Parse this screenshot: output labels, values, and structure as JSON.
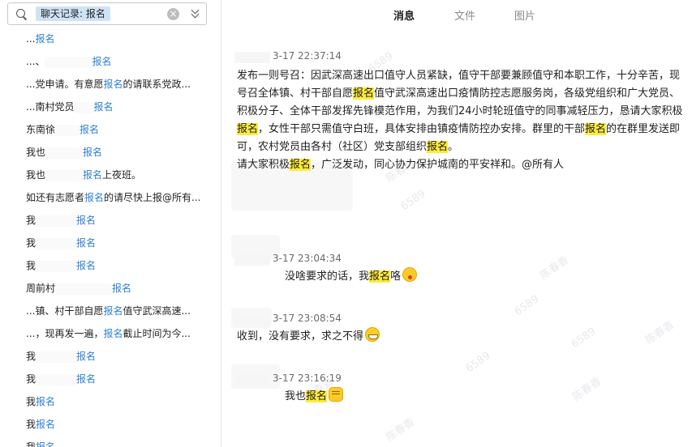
{
  "search": {
    "tag": "聊天记录: 报名",
    "clear_symbol": "×"
  },
  "results": [
    {
      "pre": "...",
      "hit": "报名",
      "post": ""
    },
    {
      "pre": "...、",
      "hit": "报名",
      "post": ""
    },
    {
      "pre": "...党申请。有意愿",
      "hit": "报名",
      "post": "的请联系党政..."
    },
    {
      "pre": "...南村党员",
      "hit": "报名",
      "post": ""
    },
    {
      "pre": "东南徐",
      "hit": "报名",
      "post": ""
    },
    {
      "pre": "我也",
      "hit": "报名",
      "post": ""
    },
    {
      "pre": "我也",
      "hit": "报名",
      "post": "上夜班。"
    },
    {
      "pre": "如还有志愿者",
      "hit": "报名",
      "post": "的请尽快上报@所有..."
    },
    {
      "pre": "我",
      "hit": "报名",
      "post": ""
    },
    {
      "pre": "我",
      "hit": "报名",
      "post": ""
    },
    {
      "pre": "我",
      "hit": "报名",
      "post": ""
    },
    {
      "pre": "周前村",
      "hit": "报名",
      "post": ""
    },
    {
      "pre": "...镇、村干部自愿",
      "hit": "报名",
      "post": "值守武深高速..."
    },
    {
      "pre": "...，现再发一遍，",
      "hit": "报名",
      "post": "截止时间为今..."
    },
    {
      "pre": "我",
      "hit": "报名",
      "post": ""
    },
    {
      "pre": "我",
      "hit": "报名",
      "post": ""
    },
    {
      "pre": "我",
      "hit": "报名",
      "post": ""
    },
    {
      "pre": "我",
      "hit": "报名",
      "post": ""
    },
    {
      "pre": "我",
      "hit": "报名",
      "post": ""
    }
  ],
  "tabs": [
    {
      "label": "消息",
      "active": true
    },
    {
      "label": "文件",
      "active": false
    },
    {
      "label": "图片",
      "active": false
    }
  ],
  "messages": [
    {
      "time": "3-17 22:37:14",
      "lines": [
        [
          {
            "t": "发布一则号召：因武深高速出口值守人员紧缺，值守干部要兼顾值守和本职工作，十分辛苦，现"
          }
        ],
        [
          {
            "t": "号召全体镇、村干部自愿"
          },
          {
            "t": "报名",
            "h": true
          },
          {
            "t": "值守武深高速出口疫情防控志愿服务岗，各级党组织和广大党员、"
          }
        ],
        [
          {
            "t": "积极分子、全体干部发挥先锋模范作用，为我们24小时轮班值守的同事减轻压力，恳请大家积极"
          }
        ],
        [
          {
            "t": "报名",
            "h": true
          },
          {
            "t": "，女性干部只需值守白班，具体安排由镇疫情防控办安排。群里的干部"
          },
          {
            "t": "报名",
            "h": true
          },
          {
            "t": "的在群里发送即"
          }
        ],
        [
          {
            "t": "可，农村党员由各村（社区）党支部组织"
          },
          {
            "t": "报名",
            "h": true
          },
          {
            "t": "。"
          }
        ],
        [
          {
            "t": "请大家积极"
          },
          {
            "t": "报名",
            "h": true
          },
          {
            "t": "，广泛发动，同心协力保护城南的平安祥和。@所有人"
          }
        ]
      ]
    },
    {
      "time": "3-17 23:04:34",
      "lines": [
        [
          {
            "t": "没啥要求的话，我"
          },
          {
            "t": "报名",
            "h": true
          },
          {
            "t": "咯"
          },
          {
            "e": "tongue"
          }
        ]
      ]
    },
    {
      "time": "3-17 23:08:54",
      "lines": [
        [
          {
            "t": "收到，没有要求，求之不得"
          },
          {
            "e": "grin"
          }
        ]
      ]
    },
    {
      "time": "3-17 23:16:19",
      "lines": [
        [
          {
            "t": "我也"
          },
          {
            "t": "报名",
            "h": true
          },
          {
            "e": "fist"
          }
        ]
      ]
    }
  ],
  "watermark": [
    "6589",
    "陈春香"
  ],
  "colors": {
    "highlight": "#ffeb3b",
    "link": "#2e7fd1",
    "search_tag_bg": "#cfe3f7"
  }
}
